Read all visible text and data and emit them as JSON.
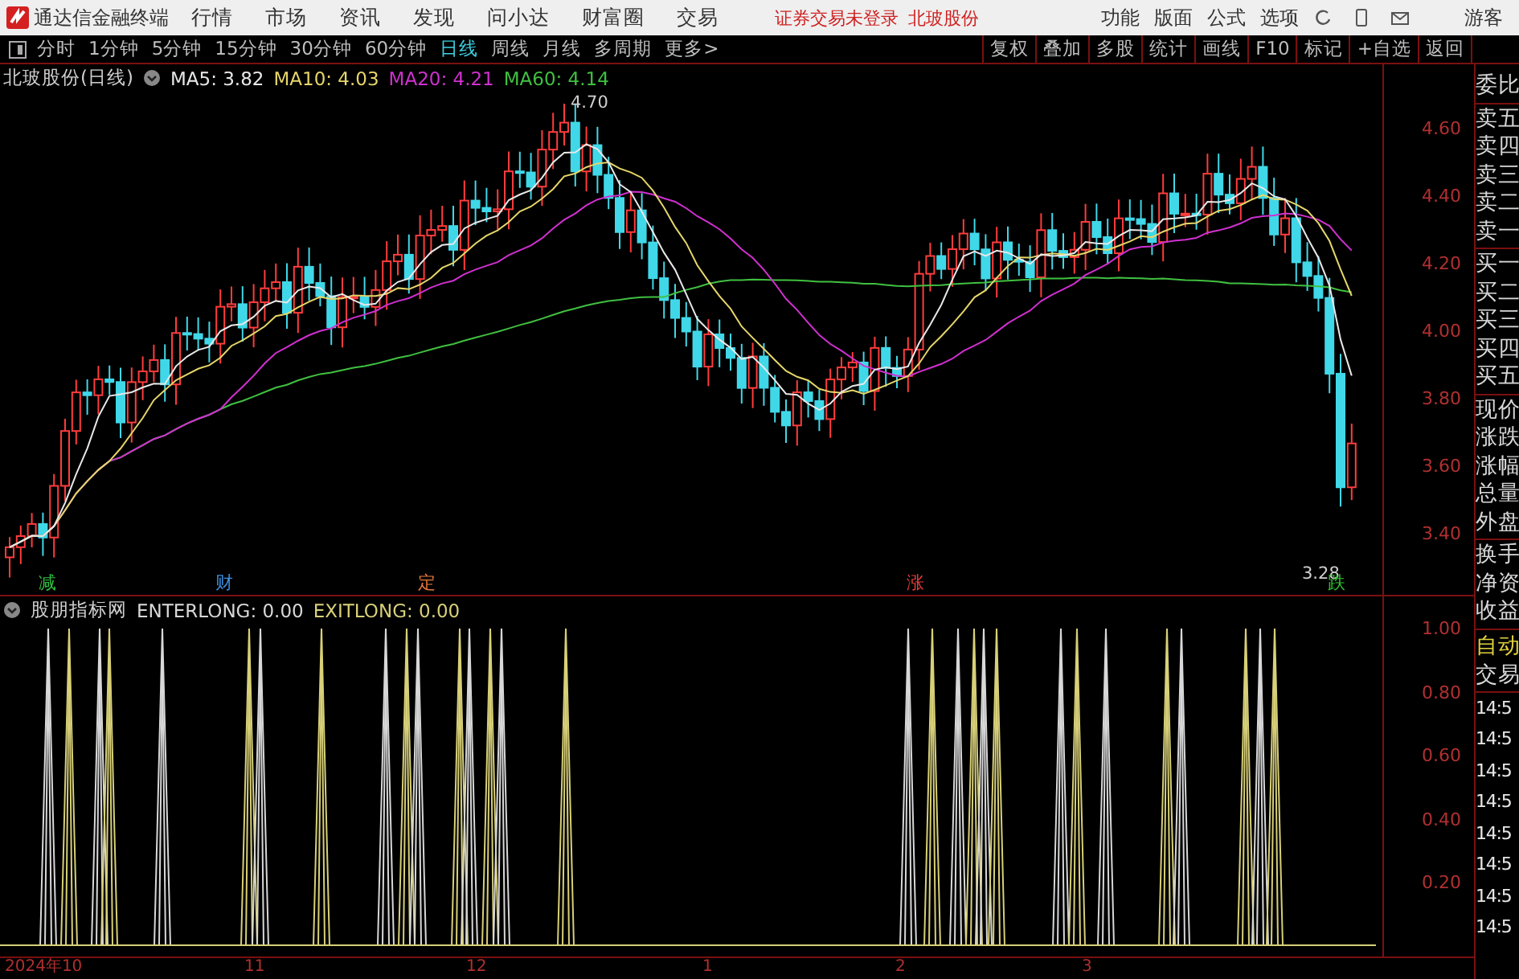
{
  "app": {
    "title": "通达信金融终端",
    "menu": [
      "行情",
      "市场",
      "资讯",
      "发现",
      "问小达",
      "财富圈",
      "交易"
    ],
    "status": [
      "证券交易未登录",
      "北玻股份"
    ],
    "right_menu": [
      "功能",
      "版面",
      "公式",
      "选项"
    ],
    "user": "游客"
  },
  "periods": [
    {
      "label": "分时",
      "selected": false
    },
    {
      "label": "1分钟",
      "selected": false
    },
    {
      "label": "5分钟",
      "selected": false
    },
    {
      "label": "15分钟",
      "selected": false
    },
    {
      "label": "30分钟",
      "selected": false
    },
    {
      "label": "60分钟",
      "selected": false
    },
    {
      "label": "日线",
      "selected": true
    },
    {
      "label": "周线",
      "selected": false
    },
    {
      "label": "月线",
      "selected": false
    },
    {
      "label": "多周期",
      "selected": false
    },
    {
      "label": "更多>",
      "selected": false
    }
  ],
  "tools": [
    "复权",
    "叠加",
    "多股",
    "统计",
    "画线",
    "F10",
    "标记",
    "+自选",
    "返回"
  ],
  "main_chart": {
    "title": "北玻股份(日线)",
    "ma": [
      {
        "label": "MA5: 3.82",
        "color": "#e8e8e8"
      },
      {
        "label": "MA10: 4.03",
        "color": "#e6d66a"
      },
      {
        "label": "MA20: 4.21",
        "color": "#d030d0"
      },
      {
        "label": "MA60: 4.14",
        "color": "#40c040"
      }
    ],
    "high_label": "4.70",
    "low_label": "3.28",
    "price_ticks": [
      "4.60",
      "4.40",
      "4.20",
      "4.00",
      "3.80",
      "3.60",
      "3.40"
    ],
    "markers": [
      {
        "label": "减",
        "color": "#2fbf3f"
      },
      {
        "label": "财",
        "color": "#3c8cdc"
      },
      {
        "label": "定",
        "color": "#e8783c"
      },
      {
        "label": "涨",
        "color": "#e03c3c"
      },
      {
        "label": "跌",
        "color": "#30c030"
      }
    ]
  },
  "indicator": {
    "title": "股朋指标网",
    "values": [
      {
        "label": "ENTERLONG: 0.00",
        "color": "#d8d8d8"
      },
      {
        "label": "EXITLONG: 0.00",
        "color": "#d8d078"
      }
    ],
    "ticks": [
      "1.00",
      "0.80",
      "0.60",
      "0.40",
      "0.20"
    ]
  },
  "date_axis": [
    "2024年10",
    "11",
    "12",
    "1",
    "2",
    "3"
  ],
  "quote_panel": {
    "groups": [
      [
        "委比"
      ],
      [
        "卖五",
        "卖四",
        "卖三",
        "卖二",
        "卖一"
      ],
      [
        "买一",
        "买二",
        "买三",
        "买四",
        "买五"
      ],
      [
        "现价",
        "涨跌",
        "涨幅",
        "总量",
        "外盘"
      ],
      [
        "换手",
        "净资",
        "收益"
      ]
    ],
    "auto_trade": [
      "自动",
      "交易"
    ],
    "times": [
      "14:5",
      "14:5",
      "14:5",
      "14:5",
      "14:5",
      "14:5",
      "14:5",
      "14:5"
    ]
  }
}
